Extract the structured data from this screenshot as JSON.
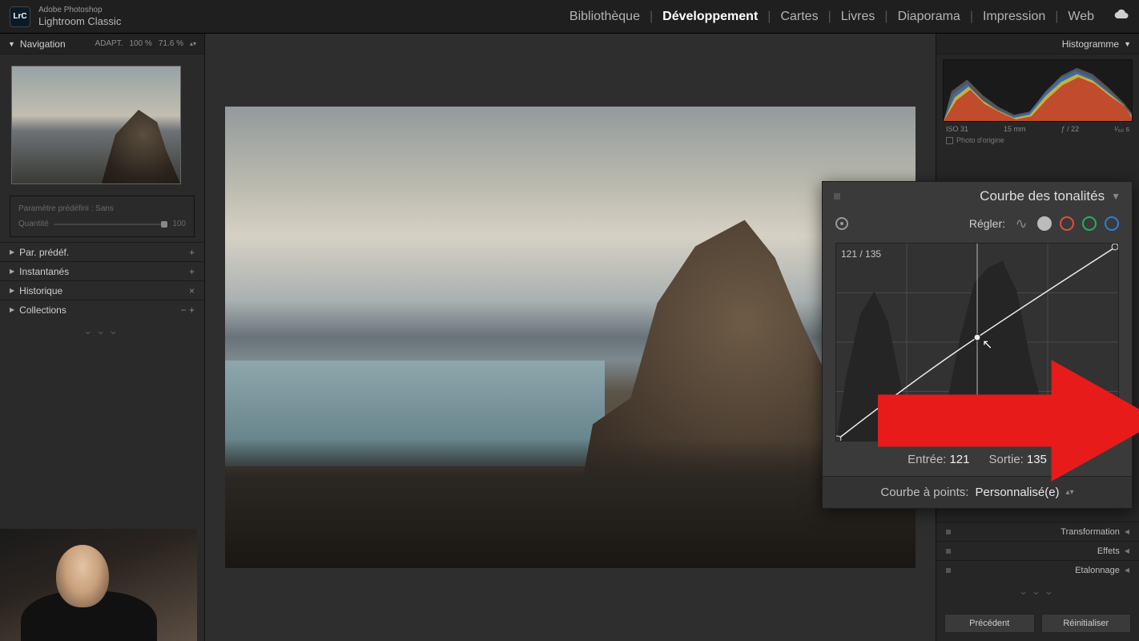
{
  "app": {
    "brand_line1": "Adobe Photoshop",
    "brand_line2": "Lightroom Classic",
    "logo": "LrC"
  },
  "modules": {
    "library": "Bibliothèque",
    "develop": "Développement",
    "map": "Cartes",
    "book": "Livres",
    "slideshow": "Diaporama",
    "print": "Impression",
    "web": "Web"
  },
  "navigator": {
    "title": "Navigation",
    "fit_label": "ADAPT.",
    "zoom1": "100 %",
    "zoom2": "71.6 %"
  },
  "preset_box": {
    "label": "Paramètre prédéfini : Sans",
    "amount_label": "Quantité",
    "amount_value": "100"
  },
  "left_panels": {
    "presets": "Par. prédéf.",
    "snapshots": "Instantanés",
    "history": "Historique",
    "collections": "Collections"
  },
  "histogram": {
    "title": "Histogramme",
    "iso": "ISO 31",
    "focal": "15 mm",
    "aperture": "ƒ / 22",
    "speed": "¹⁄₆₀ s",
    "original_label": "Photo d'origine"
  },
  "tone_curve": {
    "title": "Courbe des tonalités",
    "adjust_label": "Régler:",
    "readout": "121 / 135",
    "input_label": "Entrée:",
    "input_value": "121",
    "output_label": "Sortie:",
    "output_value": "135",
    "point_curve_label": "Courbe à points:",
    "point_curve_value": "Personnalisé(e)"
  },
  "right_collapsed": {
    "transform": "Transformation",
    "effects": "Effets",
    "calibration": "Etalonnage"
  },
  "buttons": {
    "prev": "Précédent",
    "reset": "Réinitialiser"
  }
}
